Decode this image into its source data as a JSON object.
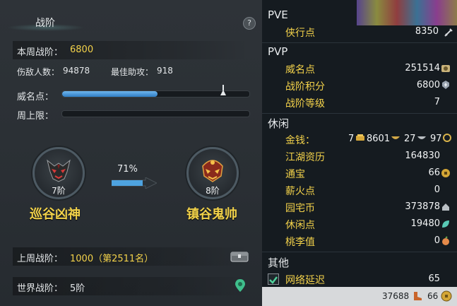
{
  "panel": {
    "title": "战阶",
    "help": "?",
    "weekly_label": "本周战阶：",
    "weekly_value": "6800",
    "kills_label": "伤敌人数：",
    "kills_value": "94878",
    "assist_label": "最佳助攻：",
    "assist_value": "918",
    "fame_label": "威名点：",
    "fame_progress": 0.51,
    "weekly_cap_label": "周上限：",
    "weekly_cap_progress": 0,
    "current_rank": "7阶",
    "current_title": "巡谷凶神",
    "progress_pct": "71%",
    "next_rank": "8阶",
    "next_title": "镇谷鬼帅",
    "last_week_label": "上周战阶：",
    "last_week_value": "1000（第2511名）",
    "world_label": "世界战阶：",
    "world_value": "5阶"
  },
  "stats": {
    "pve_header": "PVE",
    "pve_items": [
      {
        "label": "侠行点",
        "value": "8350"
      }
    ],
    "pvp_header": "PVP",
    "pvp_items": [
      {
        "label": "威名点",
        "value": "251514"
      },
      {
        "label": "战阶积分",
        "value": "6800"
      },
      {
        "label": "战阶等级",
        "value": "7"
      }
    ],
    "leisure_header": "休闲",
    "money_label": "金钱：",
    "money_gold": "7",
    "money_silver": "8601",
    "money_copper": "27",
    "money_x": "97",
    "leisure_items": [
      {
        "label": "江湖资历",
        "value": "164830"
      },
      {
        "label": "通宝",
        "value": "66"
      },
      {
        "label": "薪火点",
        "value": "0"
      },
      {
        "label": "园宅币",
        "value": "373878"
      },
      {
        "label": "休闲点",
        "value": "19480"
      },
      {
        "label": "桃李值",
        "value": "0"
      }
    ],
    "other_header": "其他",
    "latency_label": "网络延迟",
    "latency_value": "65",
    "footer_points": "37688",
    "footer_coins": "66"
  }
}
